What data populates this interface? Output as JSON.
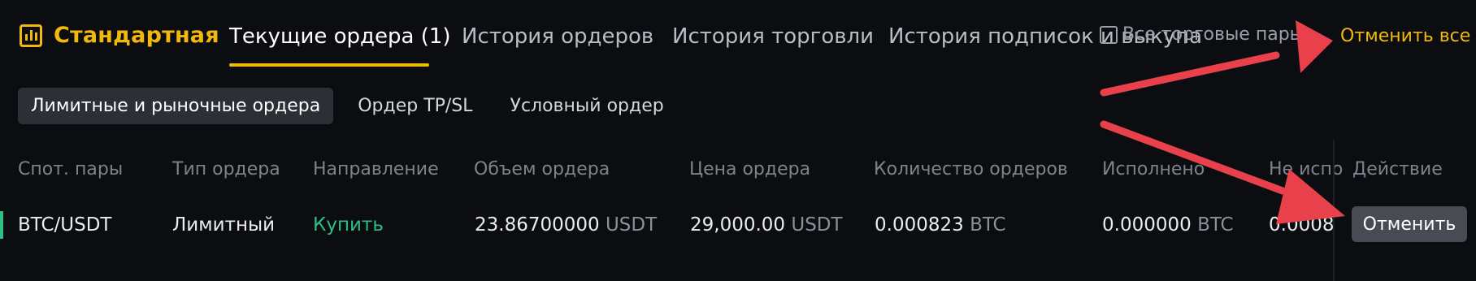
{
  "brand": {
    "label": "Стандартная",
    "icon": "chart-bars-icon"
  },
  "tabs": [
    {
      "label": "Текущие ордера (1)",
      "active": true
    },
    {
      "label": "История ордеров"
    },
    {
      "label": "История торговли"
    },
    {
      "label": "История подписок и выкупа"
    }
  ],
  "filters": {
    "all_pairs_label": "Все торговые пары",
    "cancel_all_label": "Отменить все"
  },
  "subtabs": [
    {
      "label": "Лимитные и рыночные ордера",
      "active": true
    },
    {
      "label": "Ордер TP/SL"
    },
    {
      "label": "Условный ордер"
    }
  ],
  "table": {
    "columns": [
      "Спот. пары",
      "Тип ордера",
      "Направление",
      "Объем ордера",
      "Цена ордера",
      "Количество ордеров",
      "Исполнено",
      "Не испо",
      "Действие"
    ],
    "rows": [
      {
        "pair": "BTC/USDT",
        "type": "Лимитный",
        "side": "Купить",
        "volume": "23.86700000",
        "volume_unit": "USDT",
        "price": "29,000.00",
        "price_unit": "USDT",
        "qty": "0.000823",
        "qty_unit": "BTC",
        "filled": "0.000000",
        "filled_unit": "BTC",
        "unfilled": "0.0008",
        "action_label": "Отменить"
      }
    ]
  },
  "colors": {
    "accent": "#f0b90b",
    "buy": "#2ebd85",
    "annotation_arrow": "#e8414b",
    "background": "#0c0d10"
  }
}
